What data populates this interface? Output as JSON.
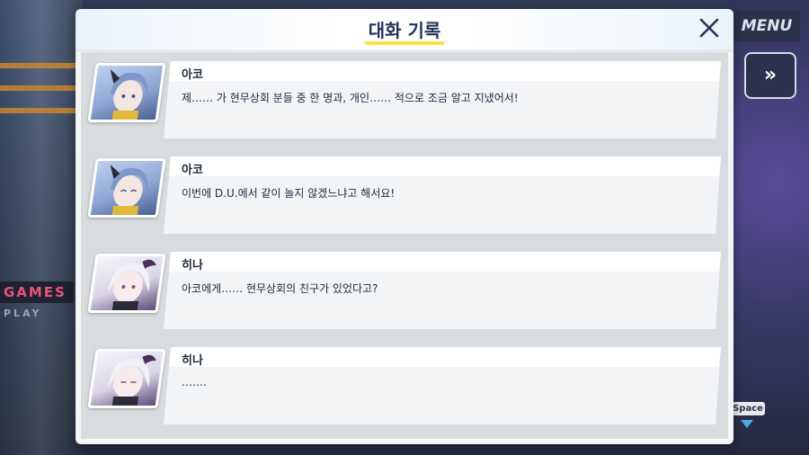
{
  "dialog": {
    "title": "대화 기록",
    "close_icon": "close-icon"
  },
  "background": {
    "menu_label": "MENU",
    "fast_forward_label": "»",
    "space_hint": "Space",
    "sign_games": "GAMES",
    "sign_play": "PLAY"
  },
  "log": [
    {
      "speaker": "아코",
      "text": "제…… 가 현무상회 분들 중 한 명과, 개인…… 적으로 조금 알고 지냈어서!",
      "portrait": "ako-portrait"
    },
    {
      "speaker": "아코",
      "text": "이번에 D.U.에서 같이 놀지 않겠느냐고 해서요!",
      "portrait": "ako-portrait"
    },
    {
      "speaker": "히나",
      "text": "아코에게…… 현무상회의 친구가 있었다고?",
      "portrait": "hina-portrait"
    },
    {
      "speaker": "히나",
      "text": "…….",
      "portrait": "hina-portrait"
    }
  ],
  "colors": {
    "title_underline": "#ffe23e",
    "title_text": "#1f3457",
    "bubble": "#f3f4f6",
    "log_bg": "#d9dcdf"
  }
}
